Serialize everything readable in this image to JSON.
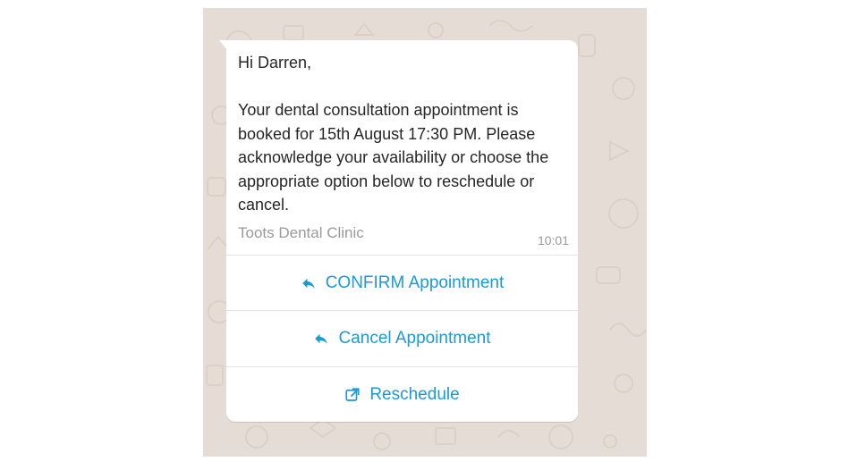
{
  "message": {
    "greeting": "Hi Darren,",
    "body": "Your dental consultation appointment is booked for 15th August 17:30 PM. Please acknowledge your availability or choose the appropriate option below to reschedule or cancel.",
    "footer": "Toots Dental Clinic",
    "time": "10:01"
  },
  "actions": [
    {
      "label": "CONFIRM Appointment",
      "icon": "reply-icon"
    },
    {
      "label": "Cancel Appointment",
      "icon": "reply-icon"
    },
    {
      "label": "Reschedule",
      "icon": "external-link-icon"
    }
  ],
  "colors": {
    "chat_background": "#e5ddd5",
    "bubble": "#ffffff",
    "action_text": "#1a9ad6",
    "secondary_text": "#9a9a9a"
  }
}
